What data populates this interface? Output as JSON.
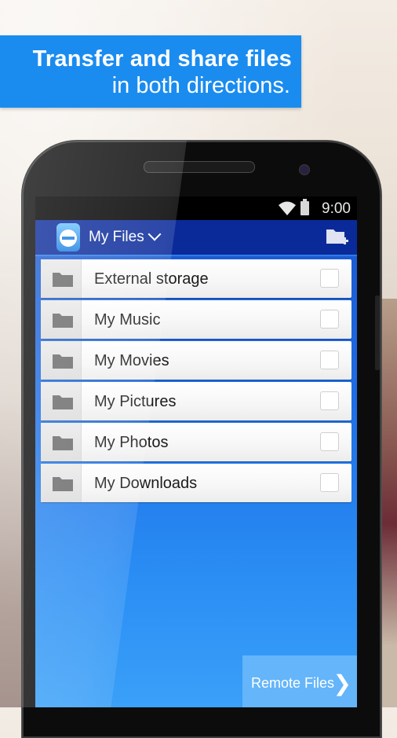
{
  "banner": {
    "headline": "Transfer and share files",
    "subline": "in both directions."
  },
  "statusbar": {
    "time": "9:00",
    "icons": [
      "wifi-icon",
      "battery-icon"
    ]
  },
  "appbar": {
    "logo": "teamviewer-logo-icon",
    "title": "My Files",
    "dropdown_icon": "chevron-down-icon",
    "action_icon": "new-folder-icon"
  },
  "files": [
    {
      "label": "External storage",
      "icon": "folder-icon",
      "checked": false
    },
    {
      "label": "My Music",
      "icon": "folder-icon",
      "checked": false
    },
    {
      "label": "My Movies",
      "icon": "folder-icon",
      "checked": false
    },
    {
      "label": "My Pictures",
      "icon": "folder-icon",
      "checked": false
    },
    {
      "label": "My Photos",
      "icon": "folder-icon",
      "checked": false
    },
    {
      "label": "My Downloads",
      "icon": "folder-icon",
      "checked": false
    }
  ],
  "remote_button": {
    "label": "Remote Files",
    "chevron": "❯"
  },
  "colors": {
    "banner": "#1a8cf0",
    "appbar": "#0a2a9a",
    "remote_button": "#64b5fa"
  }
}
